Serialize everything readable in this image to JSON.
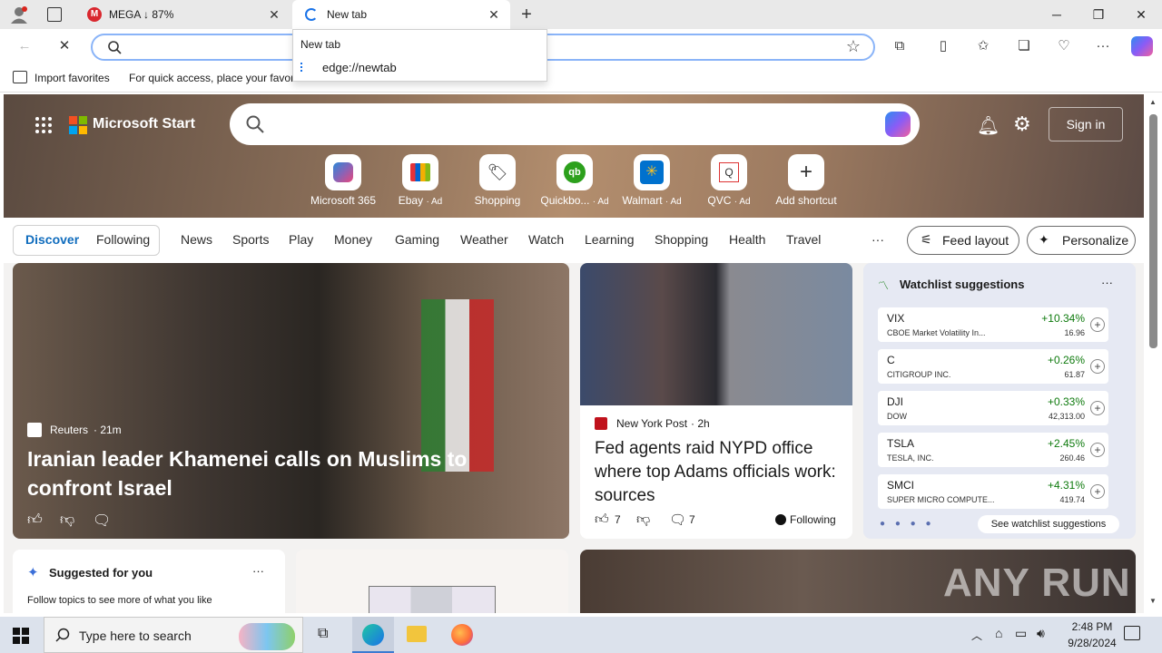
{
  "tabs": [
    {
      "title": "MEGA ↓ 87%"
    },
    {
      "title": "New tab"
    }
  ],
  "address": {
    "value": "",
    "dropdown_title": "New tab",
    "dropdown_url": "edge://newtab"
  },
  "bookmarks": {
    "import": "Import favorites",
    "hint": "For quick access, place your favori"
  },
  "msn": {
    "brand": "Microsoft Start",
    "signin": "Sign in",
    "shortcuts": [
      {
        "label": "Microsoft 365",
        "ad": ""
      },
      {
        "label": "Ebay",
        "ad": "· Ad"
      },
      {
        "label": "Shopping",
        "ad": ""
      },
      {
        "label": "Quickbo...",
        "ad": "· Ad"
      },
      {
        "label": "Walmart",
        "ad": "· Ad"
      },
      {
        "label": "QVC",
        "ad": "· Ad"
      },
      {
        "label": "Add shortcut",
        "ad": ""
      }
    ],
    "nav": [
      "Discover",
      "Following",
      "News",
      "Sports",
      "Play",
      "Money",
      "Gaming",
      "Weather",
      "Watch",
      "Learning",
      "Shopping",
      "Health",
      "Travel"
    ],
    "more": "···",
    "feed_layout": "Feed layout",
    "personalize": "Personalize"
  },
  "main_story": {
    "source": "Reuters",
    "time": "· 21m",
    "headline": "Iranian leader Khamenei calls on Muslims to confront Israel"
  },
  "second_story": {
    "source": "New York Post",
    "time": "· 2h",
    "headline": "Fed agents raid NYPD office where top Adams officials work: sources",
    "likes": "7",
    "comments": "7",
    "following": "Following"
  },
  "watchlist": {
    "title": "Watchlist suggestions",
    "more": "···",
    "rows": [
      {
        "symbol": "VIX",
        "name": "CBOE Market Volatility In...",
        "change": "+10.34%",
        "value": "16.96"
      },
      {
        "symbol": "C",
        "name": "CITIGROUP INC.",
        "change": "+0.26%",
        "value": "61.87"
      },
      {
        "symbol": "DJI",
        "name": "DOW",
        "change": "+0.33%",
        "value": "42,313.00"
      },
      {
        "symbol": "TSLA",
        "name": "TESLA, INC.",
        "change": "+2.45%",
        "value": "260.46"
      },
      {
        "symbol": "SMCI",
        "name": "SUPER MICRO COMPUTE...",
        "change": "+4.31%",
        "value": "419.74"
      }
    ],
    "see_more": "See watchlist suggestions"
  },
  "suggested": {
    "title": "Suggested for you",
    "more": "···",
    "text": "Follow topics to see more of what you like"
  },
  "watermark": "ANY RUN",
  "taskbar": {
    "search_placeholder": "Type here to search",
    "time": "2:48 PM",
    "date": "9/28/2024"
  }
}
